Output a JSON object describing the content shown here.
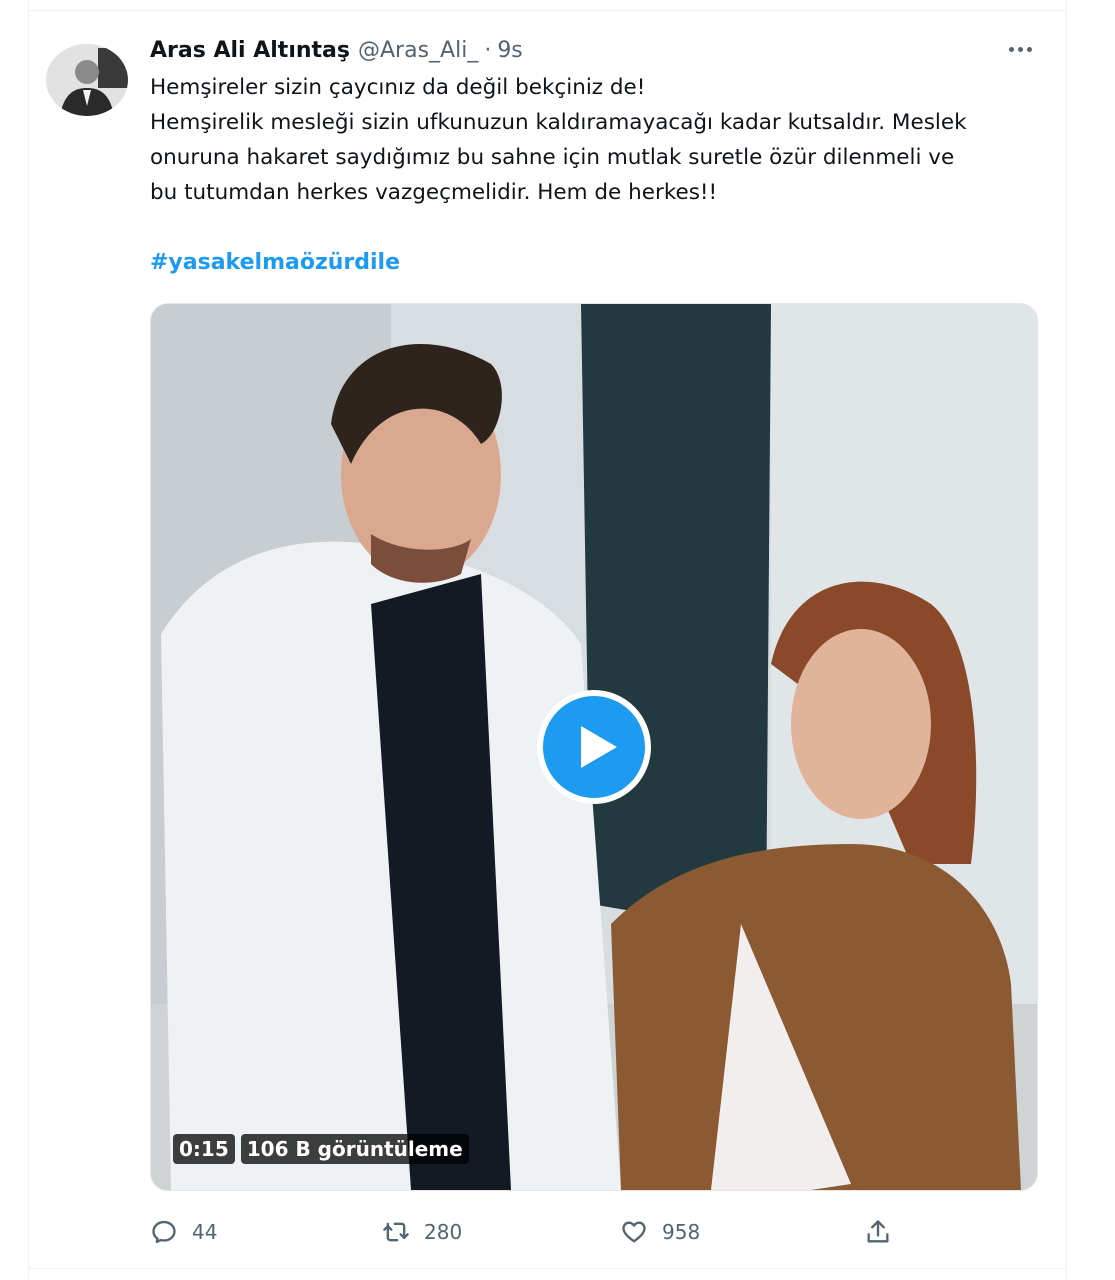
{
  "tweet": {
    "author_name": "Aras Ali Altıntaş",
    "handle": "@Aras_Ali_",
    "separator": "·",
    "time": "9s",
    "text_lines": [
      "Hemşireler sizin çaycınız da değil bekçiniz de!",
      "Hemşirelik mesleği sizin ufkunuzun kaldıramayacağı kadar kutsaldır. Meslek",
      "onuruna hakaret saydığımız bu sahne için mutlak suretle özür dilenmeli ve",
      "bu tutumdan herkes vazgeçmelidir. Hem de herkes!!"
    ],
    "hashtag": "#yasakelmaözürdile"
  },
  "video": {
    "duration": "0:15",
    "views": "106 B görüntüleme"
  },
  "actions": {
    "replies": "44",
    "retweets": "280",
    "likes": "958"
  },
  "icons": {
    "avatar": "avatar-icon",
    "more": "more-icon",
    "play": "play-icon",
    "reply": "reply-icon",
    "retweet": "retweet-icon",
    "like": "heart-icon",
    "share": "share-icon"
  },
  "colors": {
    "accent": "#1d9bf0",
    "secondary_text": "#536471",
    "primary_text": "#0f1419"
  }
}
